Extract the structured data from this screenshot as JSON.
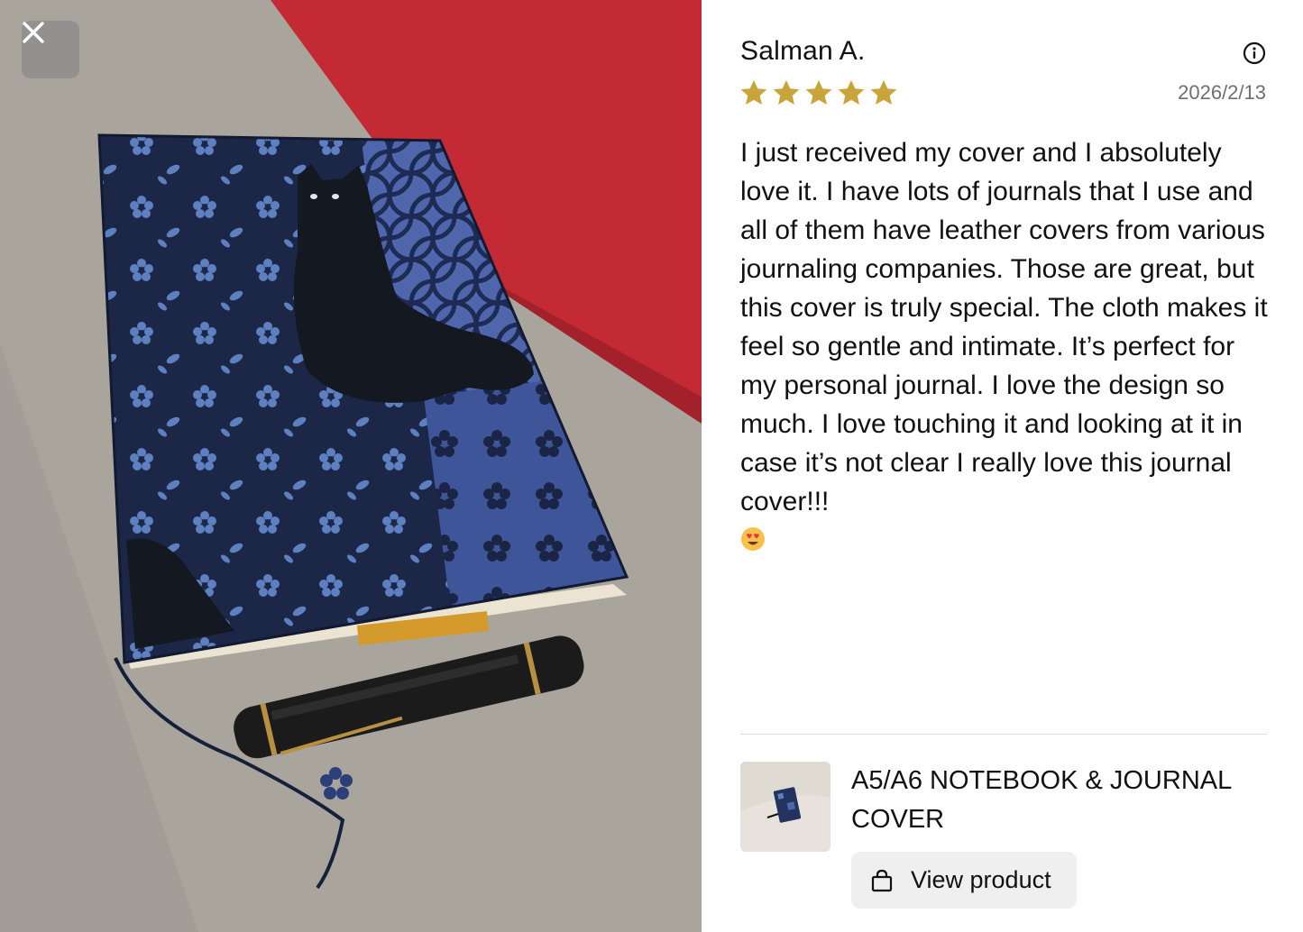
{
  "review": {
    "author": "Salman A.",
    "rating": 5,
    "rating_max": 5,
    "date": "2026/2/13",
    "text": "I just received my cover and I absolutely love it. I have lots of journals that I use and all of them have leather covers from various journaling companies. Those are great, but this cover is truly special. The cloth makes it feel so gentle and intimate. It’s perfect for my personal journal. I love the design so much. I love touching it and looking at it in case it’s not clear I really love this journal cover!!!",
    "emoji_icon": "heart-eyes-emoji-icon"
  },
  "product": {
    "name": "A5/A6 NOTEBOOK & JOURNAL COVER",
    "view_label": "View product"
  },
  "icons": {
    "close": "close-icon",
    "info": "info-icon",
    "star": "star-icon",
    "bag": "shopping-bag-icon"
  },
  "colors": {
    "star": "#c9a43a",
    "button_bg": "#efefef",
    "date_text": "#6f6f6f"
  }
}
